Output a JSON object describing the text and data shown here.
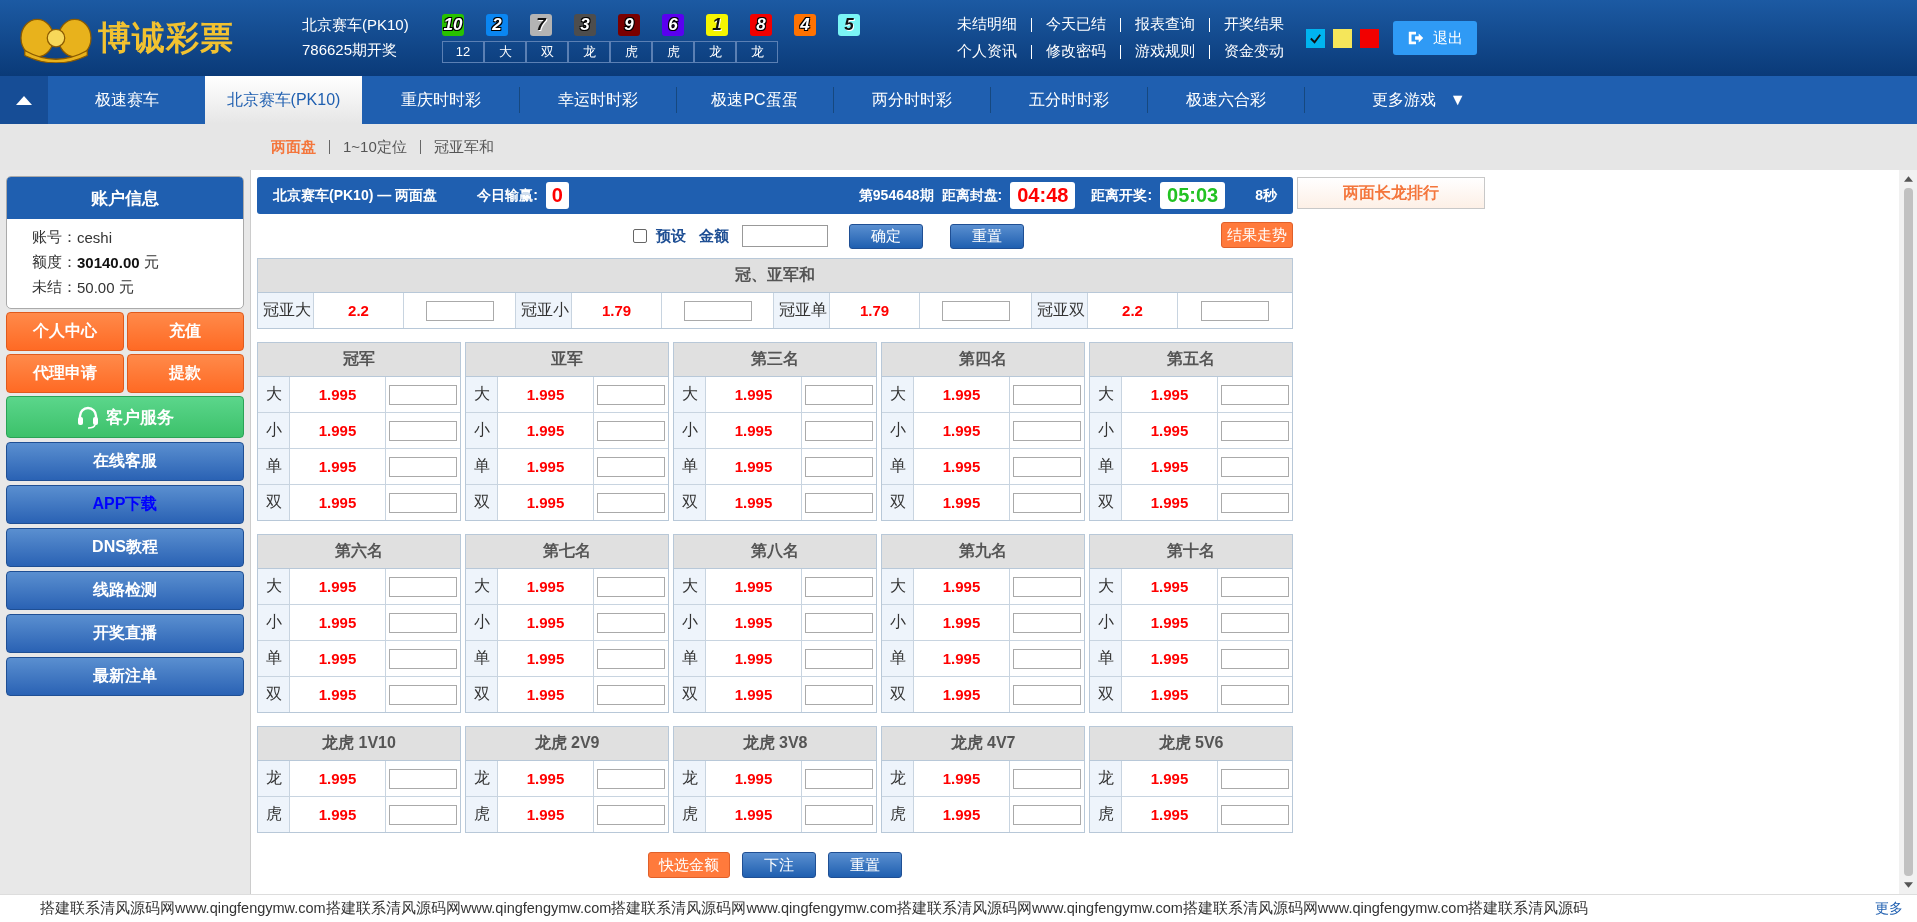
{
  "header": {
    "logo": "博诚彩票",
    "game": "北京赛车(PK10)",
    "draw": "786625期开奖",
    "balls": [
      {
        "number": "10",
        "color": "#28c200"
      },
      {
        "number": "2",
        "color": "#0a86f2"
      },
      {
        "number": "7",
        "color": "#b4b4b4"
      },
      {
        "number": "3",
        "color": "#4d4d4d"
      },
      {
        "number": "9",
        "color": "#7a0000"
      },
      {
        "number": "6",
        "color": "#5a00f0"
      },
      {
        "number": "1",
        "color": "#f5f500"
      },
      {
        "number": "8",
        "color": "#f20000"
      },
      {
        "number": "4",
        "color": "#ff7200"
      },
      {
        "number": "5",
        "color": "#7af5f5"
      }
    ],
    "results": [
      "12",
      "大",
      "双",
      "龙",
      "虎",
      "虎",
      "龙",
      "龙"
    ],
    "links": [
      [
        "未结明细",
        "今天已结",
        "报表查询",
        "开奖结果"
      ],
      [
        "个人资讯",
        "修改密码",
        "游戏规则",
        "资金变动"
      ]
    ],
    "themes": [
      {
        "color": "#00b4f0",
        "selected": true
      },
      {
        "color": "#f5e65a",
        "selected": false
      },
      {
        "color": "#f20000",
        "selected": false
      }
    ],
    "logout": "退出"
  },
  "nav": {
    "tabs": [
      {
        "label": "极速赛车",
        "selected": false
      },
      {
        "label": "北京赛车(PK10)",
        "selected": true
      },
      {
        "label": "重庆时时彩",
        "selected": false
      },
      {
        "label": "幸运时时彩",
        "selected": false
      },
      {
        "label": "极速PC蛋蛋",
        "selected": false
      },
      {
        "label": "两分时时彩",
        "selected": false
      },
      {
        "label": "五分时时彩",
        "selected": false
      },
      {
        "label": "极速六合彩",
        "selected": false
      }
    ],
    "more": "更多游戏",
    "more_caret": "▼"
  },
  "subnav": [
    {
      "label": "两面盘",
      "selected": true
    },
    {
      "label": "1~10定位",
      "selected": false
    },
    {
      "label": "冠亚军和",
      "selected": false
    }
  ],
  "sidebar": {
    "title": "账户信息",
    "fields": [
      {
        "label": "账号：",
        "value": "ceshi",
        "strong": false
      },
      {
        "label": "额度：",
        "value": "30140.00",
        "unit": "元",
        "strong": true
      },
      {
        "label": "未结：",
        "value": "50.00",
        "unit": "元",
        "strong": false
      }
    ],
    "buttons": [
      {
        "label": "个人中心",
        "kind": "orange"
      },
      {
        "label": "充值",
        "kind": "orange"
      },
      {
        "label": "代理申请",
        "kind": "orange"
      },
      {
        "label": "提款",
        "kind": "orange"
      },
      {
        "label": "客户服务",
        "kind": "service"
      },
      {
        "label": "在线客服",
        "kind": "blue"
      },
      {
        "label": "APP下载",
        "kind": "link"
      },
      {
        "label": "DNS教程",
        "kind": "blue"
      },
      {
        "label": "线路检测",
        "kind": "blue"
      },
      {
        "label": "开奖直播",
        "kind": "blue"
      },
      {
        "label": "最新注单",
        "kind": "blue"
      }
    ]
  },
  "main": {
    "title": "北京赛车(PK10) — 两面盘",
    "profit_label": "今日输赢:",
    "profit": "0",
    "period": "第954648期",
    "close_label": "距离封盘:",
    "close_time": "04:48",
    "open_label": "距离开奖:",
    "open_time": "05:03",
    "seconds": "8秒",
    "toolbar": {
      "preset": {
        "label": "预设",
        "checked": false
      },
      "amount_label": "金额",
      "confirm": "确定",
      "reset": "重置",
      "trend": "结果走势"
    },
    "sum": {
      "title": "冠、亚军和",
      "items": [
        {
          "name": "冠亚大",
          "odds": "2.2"
        },
        {
          "name": "冠亚小",
          "odds": "1.79"
        },
        {
          "name": "冠亚单",
          "odds": "1.79"
        },
        {
          "name": "冠亚双",
          "odds": "2.2"
        }
      ]
    },
    "groups": [
      {
        "title": "冠军",
        "rows": [
          {
            "name": "大",
            "odds": "1.995"
          },
          {
            "name": "小",
            "odds": "1.995"
          },
          {
            "name": "单",
            "odds": "1.995"
          },
          {
            "name": "双",
            "odds": "1.995"
          }
        ]
      },
      {
        "title": "亚军",
        "rows": [
          {
            "name": "大",
            "odds": "1.995"
          },
          {
            "name": "小",
            "odds": "1.995"
          },
          {
            "name": "单",
            "odds": "1.995"
          },
          {
            "name": "双",
            "odds": "1.995"
          }
        ]
      },
      {
        "title": "第三名",
        "rows": [
          {
            "name": "大",
            "odds": "1.995"
          },
          {
            "name": "小",
            "odds": "1.995"
          },
          {
            "name": "单",
            "odds": "1.995"
          },
          {
            "name": "双",
            "odds": "1.995"
          }
        ]
      },
      {
        "title": "第四名",
        "rows": [
          {
            "name": "大",
            "odds": "1.995"
          },
          {
            "name": "小",
            "odds": "1.995"
          },
          {
            "name": "单",
            "odds": "1.995"
          },
          {
            "name": "双",
            "odds": "1.995"
          }
        ]
      },
      {
        "title": "第五名",
        "rows": [
          {
            "name": "大",
            "odds": "1.995"
          },
          {
            "name": "小",
            "odds": "1.995"
          },
          {
            "name": "单",
            "odds": "1.995"
          },
          {
            "name": "双",
            "odds": "1.995"
          }
        ]
      },
      {
        "title": "第六名",
        "rows": [
          {
            "name": "大",
            "odds": "1.995"
          },
          {
            "name": "小",
            "odds": "1.995"
          },
          {
            "name": "单",
            "odds": "1.995"
          },
          {
            "name": "双",
            "odds": "1.995"
          }
        ]
      },
      {
        "title": "第七名",
        "rows": [
          {
            "name": "大",
            "odds": "1.995"
          },
          {
            "name": "小",
            "odds": "1.995"
          },
          {
            "name": "单",
            "odds": "1.995"
          },
          {
            "name": "双",
            "odds": "1.995"
          }
        ]
      },
      {
        "title": "第八名",
        "rows": [
          {
            "name": "大",
            "odds": "1.995"
          },
          {
            "name": "小",
            "odds": "1.995"
          },
          {
            "name": "单",
            "odds": "1.995"
          },
          {
            "name": "双",
            "odds": "1.995"
          }
        ]
      },
      {
        "title": "第九名",
        "rows": [
          {
            "name": "大",
            "odds": "1.995"
          },
          {
            "name": "小",
            "odds": "1.995"
          },
          {
            "name": "单",
            "odds": "1.995"
          },
          {
            "name": "双",
            "odds": "1.995"
          }
        ]
      },
      {
        "title": "第十名",
        "rows": [
          {
            "name": "大",
            "odds": "1.995"
          },
          {
            "name": "小",
            "odds": "1.995"
          },
          {
            "name": "单",
            "odds": "1.995"
          },
          {
            "name": "双",
            "odds": "1.995"
          }
        ]
      },
      {
        "title": "龙虎 1V10",
        "rows": [
          {
            "name": "龙",
            "odds": "1.995"
          },
          {
            "name": "虎",
            "odds": "1.995"
          }
        ]
      },
      {
        "title": "龙虎 2V9",
        "rows": [
          {
            "name": "龙",
            "odds": "1.995"
          },
          {
            "name": "虎",
            "odds": "1.995"
          }
        ]
      },
      {
        "title": "龙虎 3V8",
        "rows": [
          {
            "name": "龙",
            "odds": "1.995"
          },
          {
            "name": "虎",
            "odds": "1.995"
          }
        ]
      },
      {
        "title": "龙虎 4V7",
        "rows": [
          {
            "name": "龙",
            "odds": "1.995"
          },
          {
            "name": "虎",
            "odds": "1.995"
          }
        ]
      },
      {
        "title": "龙虎 5V6",
        "rows": [
          {
            "name": "龙",
            "odds": "1.995"
          },
          {
            "name": "虎",
            "odds": "1.995"
          }
        ]
      }
    ],
    "actions": [
      {
        "label": "快选金额",
        "kind": "orange"
      },
      {
        "label": "下注",
        "kind": "blue"
      },
      {
        "label": "重置",
        "kind": "blue"
      }
    ]
  },
  "side_panel": {
    "title": "两面长龙排行"
  },
  "footer": {
    "marquee": "搭建联系清风源码网www.qingfengymw.com搭建联系清风源码网www.qingfengymw.com搭建联系清风源码网www.qingfengymw.com搭建联系清风源码网www.qingfengymw.com搭建联系清风源码网www.qingfengymw.com搭建联系清风源码",
    "more": "更多"
  }
}
